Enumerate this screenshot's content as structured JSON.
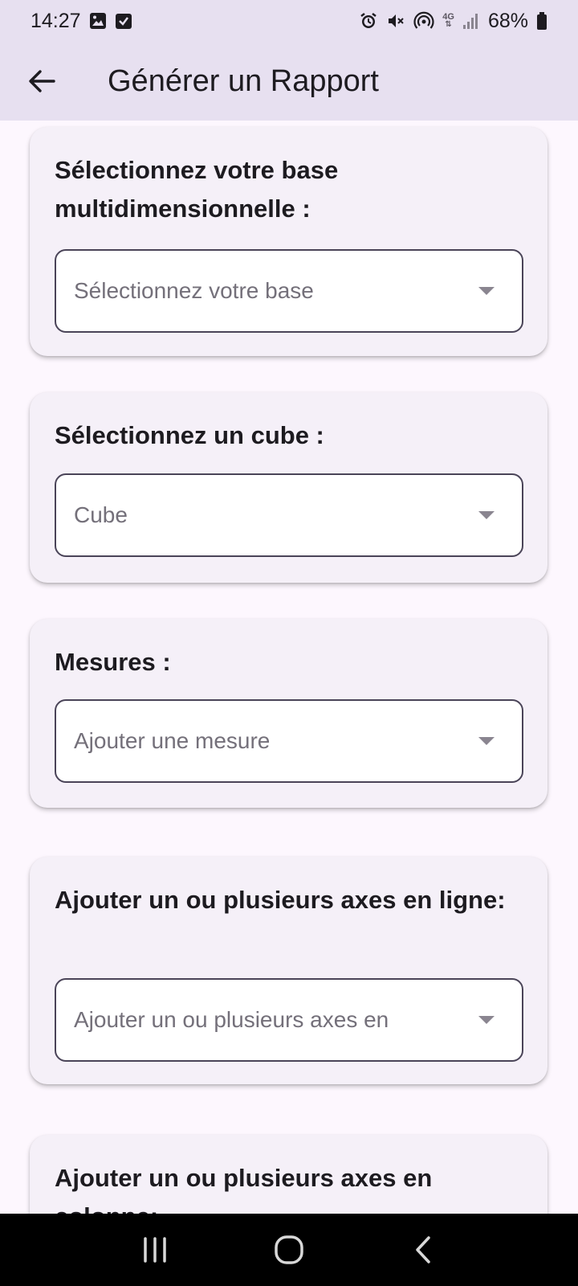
{
  "status_bar": {
    "time": "14:27",
    "battery": "68%",
    "network": "4G"
  },
  "app_bar": {
    "title": "Générer un Rapport"
  },
  "cards": [
    {
      "label": "Sélectionnez votre base multidimensionnelle :",
      "placeholder": "Sélectionnez votre base"
    },
    {
      "label": "Sélectionnez un cube :",
      "placeholder": "Cube"
    },
    {
      "label": "Mesures :",
      "placeholder": "Ajouter une mesure"
    },
    {
      "label": "Ajouter un ou plusieurs axes en ligne:",
      "placeholder": "Ajouter un ou plusieurs axes en"
    },
    {
      "label": "Ajouter un ou plusieurs axes en colonne:"
    }
  ],
  "colors": {
    "app_bar_bg": "#e7e0f0",
    "page_bg": "#fdf7fe",
    "card_bg": "#f5f0f8",
    "outline": "#4a4458"
  }
}
